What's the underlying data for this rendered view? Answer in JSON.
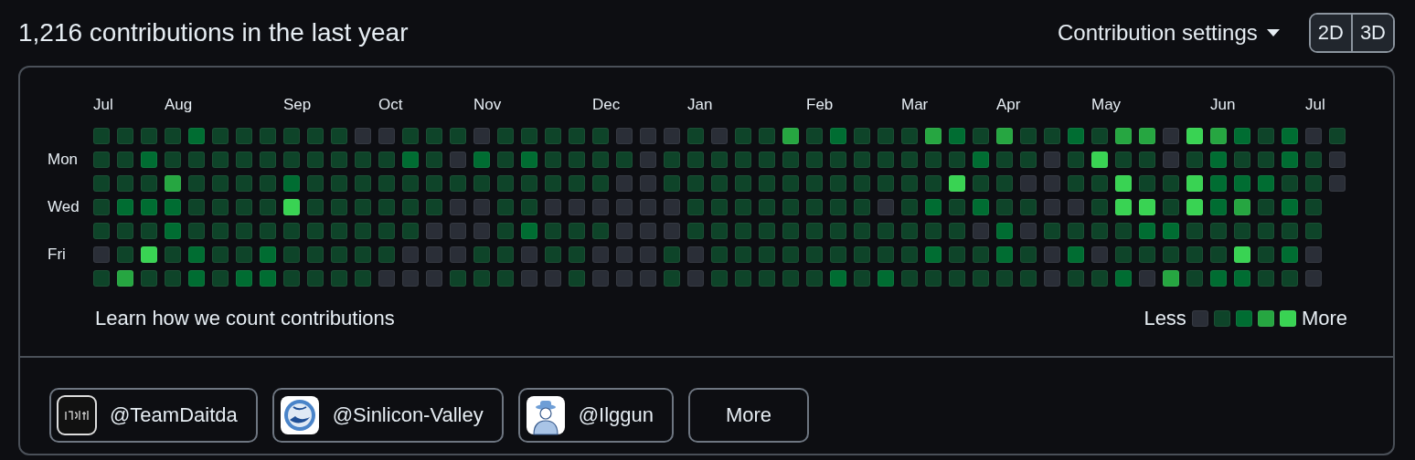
{
  "title": "1,216 contributions in the last year",
  "settings": {
    "label": "Contribution settings"
  },
  "view_toggle": [
    {
      "label": "2D"
    },
    {
      "label": "3D"
    }
  ],
  "day_labels": [
    "Mon",
    "Wed",
    "Fri"
  ],
  "weeks": [
    {
      "month": "Jul",
      "days": [
        {
          "color": "#0e4429"
        },
        {
          "color": "#0e4429"
        },
        {
          "color": "#0e4429"
        },
        {
          "color": "#0e4429"
        },
        {
          "color": "#0e4429"
        },
        {
          "color": "#2a2e37"
        },
        {
          "color": "#0e4429"
        }
      ]
    },
    {
      "days": [
        {
          "color": "#0e4429"
        },
        {
          "color": "#0e4429"
        },
        {
          "color": "#0e4429"
        },
        {
          "color": "#006d32"
        },
        {
          "color": "#0e4429"
        },
        {
          "color": "#0e4429"
        },
        {
          "color": "#26a641"
        }
      ]
    },
    {
      "days": [
        {
          "color": "#0e4429"
        },
        {
          "color": "#006d32"
        },
        {
          "color": "#0e4429"
        },
        {
          "color": "#006d32"
        },
        {
          "color": "#0e4429"
        },
        {
          "color": "#39d353"
        },
        {
          "color": "#0e4429"
        }
      ]
    },
    {
      "month": "Aug",
      "days": [
        {
          "color": "#0e4429"
        },
        {
          "color": "#0e4429"
        },
        {
          "color": "#26a641"
        },
        {
          "color": "#006d32"
        },
        {
          "color": "#006d32"
        },
        {
          "color": "#0e4429"
        },
        {
          "color": "#0e4429"
        }
      ]
    },
    {
      "days": [
        {
          "color": "#006d32"
        },
        {
          "color": "#0e4429"
        },
        {
          "color": "#0e4429"
        },
        {
          "color": "#0e4429"
        },
        {
          "color": "#0e4429"
        },
        {
          "color": "#006d32"
        },
        {
          "color": "#006d32"
        }
      ]
    },
    {
      "days": [
        {
          "color": "#0e4429"
        },
        {
          "color": "#0e4429"
        },
        {
          "color": "#0e4429"
        },
        {
          "color": "#0e4429"
        },
        {
          "color": "#0e4429"
        },
        {
          "color": "#0e4429"
        },
        {
          "color": "#0e4429"
        }
      ]
    },
    {
      "days": [
        {
          "color": "#0e4429"
        },
        {
          "color": "#0e4429"
        },
        {
          "color": "#0e4429"
        },
        {
          "color": "#0e4429"
        },
        {
          "color": "#0e4429"
        },
        {
          "color": "#0e4429"
        },
        {
          "color": "#006d32"
        }
      ]
    },
    {
      "days": [
        {
          "color": "#0e4429"
        },
        {
          "color": "#0e4429"
        },
        {
          "color": "#0e4429"
        },
        {
          "color": "#0e4429"
        },
        {
          "color": "#0e4429"
        },
        {
          "color": "#006d32"
        },
        {
          "color": "#006d32"
        }
      ]
    },
    {
      "month": "Sep",
      "days": [
        {
          "color": "#0e4429"
        },
        {
          "color": "#0e4429"
        },
        {
          "color": "#006d32"
        },
        {
          "color": "#39d353"
        },
        {
          "color": "#0e4429"
        },
        {
          "color": "#0e4429"
        },
        {
          "color": "#0e4429"
        }
      ]
    },
    {
      "days": [
        {
          "color": "#0e4429"
        },
        {
          "color": "#0e4429"
        },
        {
          "color": "#0e4429"
        },
        {
          "color": "#0e4429"
        },
        {
          "color": "#0e4429"
        },
        {
          "color": "#0e4429"
        },
        {
          "color": "#0e4429"
        }
      ]
    },
    {
      "days": [
        {
          "color": "#0e4429"
        },
        {
          "color": "#0e4429"
        },
        {
          "color": "#0e4429"
        },
        {
          "color": "#0e4429"
        },
        {
          "color": "#0e4429"
        },
        {
          "color": "#0e4429"
        },
        {
          "color": "#0e4429"
        }
      ]
    },
    {
      "days": [
        {
          "color": "#2a2e37"
        },
        {
          "color": "#0e4429"
        },
        {
          "color": "#0e4429"
        },
        {
          "color": "#0e4429"
        },
        {
          "color": "#0e4429"
        },
        {
          "color": "#0e4429"
        },
        {
          "color": "#0e4429"
        }
      ]
    },
    {
      "month": "Oct",
      "days": [
        {
          "color": "#2a2e37"
        },
        {
          "color": "#0e4429"
        },
        {
          "color": "#0e4429"
        },
        {
          "color": "#0e4429"
        },
        {
          "color": "#0e4429"
        },
        {
          "color": "#0e4429"
        },
        {
          "color": "#2a2e37"
        }
      ]
    },
    {
      "days": [
        {
          "color": "#0e4429"
        },
        {
          "color": "#006d32"
        },
        {
          "color": "#0e4429"
        },
        {
          "color": "#0e4429"
        },
        {
          "color": "#0e4429"
        },
        {
          "color": "#2a2e37"
        },
        {
          "color": "#2a2e37"
        }
      ]
    },
    {
      "days": [
        {
          "color": "#0e4429"
        },
        {
          "color": "#0e4429"
        },
        {
          "color": "#0e4429"
        },
        {
          "color": "#0e4429"
        },
        {
          "color": "#2a2e37"
        },
        {
          "color": "#2a2e37"
        },
        {
          "color": "#2a2e37"
        }
      ]
    },
    {
      "days": [
        {
          "color": "#0e4429"
        },
        {
          "color": "#2a2e37"
        },
        {
          "color": "#0e4429"
        },
        {
          "color": "#2a2e37"
        },
        {
          "color": "#2a2e37"
        },
        {
          "color": "#2a2e37"
        },
        {
          "color": "#0e4429"
        }
      ]
    },
    {
      "month": "Nov",
      "days": [
        {
          "color": "#2a2e37"
        },
        {
          "color": "#006d32"
        },
        {
          "color": "#0e4429"
        },
        {
          "color": "#2a2e37"
        },
        {
          "color": "#2a2e37"
        },
        {
          "color": "#0e4429"
        },
        {
          "color": "#0e4429"
        }
      ]
    },
    {
      "days": [
        {
          "color": "#0e4429"
        },
        {
          "color": "#0e4429"
        },
        {
          "color": "#0e4429"
        },
        {
          "color": "#0e4429"
        },
        {
          "color": "#0e4429"
        },
        {
          "color": "#0e4429"
        },
        {
          "color": "#0e4429"
        }
      ]
    },
    {
      "days": [
        {
          "color": "#0e4429"
        },
        {
          "color": "#006d32"
        },
        {
          "color": "#0e4429"
        },
        {
          "color": "#0e4429"
        },
        {
          "color": "#006d32"
        },
        {
          "color": "#2a2e37"
        },
        {
          "color": "#2a2e37"
        }
      ]
    },
    {
      "days": [
        {
          "color": "#0e4429"
        },
        {
          "color": "#0e4429"
        },
        {
          "color": "#0e4429"
        },
        {
          "color": "#2a2e37"
        },
        {
          "color": "#0e4429"
        },
        {
          "color": "#0e4429"
        },
        {
          "color": "#2a2e37"
        }
      ]
    },
    {
      "days": [
        {
          "color": "#0e4429"
        },
        {
          "color": "#0e4429"
        },
        {
          "color": "#0e4429"
        },
        {
          "color": "#2a2e37"
        },
        {
          "color": "#0e4429"
        },
        {
          "color": "#0e4429"
        },
        {
          "color": "#0e4429"
        }
      ]
    },
    {
      "month": "Dec",
      "days": [
        {
          "color": "#0e4429"
        },
        {
          "color": "#0e4429"
        },
        {
          "color": "#0e4429"
        },
        {
          "color": "#2a2e37"
        },
        {
          "color": "#0e4429"
        },
        {
          "color": "#2a2e37"
        },
        {
          "color": "#2a2e37"
        }
      ]
    },
    {
      "days": [
        {
          "color": "#2a2e37"
        },
        {
          "color": "#0e4429"
        },
        {
          "color": "#2a2e37"
        },
        {
          "color": "#2a2e37"
        },
        {
          "color": "#2a2e37"
        },
        {
          "color": "#2a2e37"
        },
        {
          "color": "#2a2e37"
        }
      ]
    },
    {
      "days": [
        {
          "color": "#2a2e37"
        },
        {
          "color": "#2a2e37"
        },
        {
          "color": "#2a2e37"
        },
        {
          "color": "#2a2e37"
        },
        {
          "color": "#2a2e37"
        },
        {
          "color": "#2a2e37"
        },
        {
          "color": "#2a2e37"
        }
      ]
    },
    {
      "days": [
        {
          "color": "#2a2e37"
        },
        {
          "color": "#0e4429"
        },
        {
          "color": "#0e4429"
        },
        {
          "color": "#2a2e37"
        },
        {
          "color": "#2a2e37"
        },
        {
          "color": "#0e4429"
        },
        {
          "color": "#0e4429"
        }
      ]
    },
    {
      "month": "Jan",
      "days": [
        {
          "color": "#0e4429"
        },
        {
          "color": "#0e4429"
        },
        {
          "color": "#0e4429"
        },
        {
          "color": "#0e4429"
        },
        {
          "color": "#0e4429"
        },
        {
          "color": "#2a2e37"
        },
        {
          "color": "#2a2e37"
        }
      ]
    },
    {
      "days": [
        {
          "color": "#2a2e37"
        },
        {
          "color": "#0e4429"
        },
        {
          "color": "#0e4429"
        },
        {
          "color": "#0e4429"
        },
        {
          "color": "#0e4429"
        },
        {
          "color": "#0e4429"
        },
        {
          "color": "#0e4429"
        }
      ]
    },
    {
      "days": [
        {
          "color": "#0e4429"
        },
        {
          "color": "#0e4429"
        },
        {
          "color": "#0e4429"
        },
        {
          "color": "#0e4429"
        },
        {
          "color": "#0e4429"
        },
        {
          "color": "#0e4429"
        },
        {
          "color": "#0e4429"
        }
      ]
    },
    {
      "days": [
        {
          "color": "#0e4429"
        },
        {
          "color": "#0e4429"
        },
        {
          "color": "#0e4429"
        },
        {
          "color": "#0e4429"
        },
        {
          "color": "#0e4429"
        },
        {
          "color": "#0e4429"
        },
        {
          "color": "#0e4429"
        }
      ]
    },
    {
      "days": [
        {
          "color": "#26a641"
        },
        {
          "color": "#0e4429"
        },
        {
          "color": "#0e4429"
        },
        {
          "color": "#0e4429"
        },
        {
          "color": "#0e4429"
        },
        {
          "color": "#0e4429"
        },
        {
          "color": "#0e4429"
        }
      ]
    },
    {
      "month": "Feb",
      "days": [
        {
          "color": "#0e4429"
        },
        {
          "color": "#0e4429"
        },
        {
          "color": "#0e4429"
        },
        {
          "color": "#0e4429"
        },
        {
          "color": "#0e4429"
        },
        {
          "color": "#0e4429"
        },
        {
          "color": "#0e4429"
        }
      ]
    },
    {
      "days": [
        {
          "color": "#006d32"
        },
        {
          "color": "#0e4429"
        },
        {
          "color": "#0e4429"
        },
        {
          "color": "#0e4429"
        },
        {
          "color": "#0e4429"
        },
        {
          "color": "#0e4429"
        },
        {
          "color": "#006d32"
        }
      ]
    },
    {
      "days": [
        {
          "color": "#0e4429"
        },
        {
          "color": "#0e4429"
        },
        {
          "color": "#0e4429"
        },
        {
          "color": "#0e4429"
        },
        {
          "color": "#0e4429"
        },
        {
          "color": "#0e4429"
        },
        {
          "color": "#0e4429"
        }
      ]
    },
    {
      "days": [
        {
          "color": "#0e4429"
        },
        {
          "color": "#0e4429"
        },
        {
          "color": "#0e4429"
        },
        {
          "color": "#2a2e37"
        },
        {
          "color": "#0e4429"
        },
        {
          "color": "#0e4429"
        },
        {
          "color": "#006d32"
        }
      ]
    },
    {
      "month": "Mar",
      "days": [
        {
          "color": "#0e4429"
        },
        {
          "color": "#0e4429"
        },
        {
          "color": "#0e4429"
        },
        {
          "color": "#0e4429"
        },
        {
          "color": "#0e4429"
        },
        {
          "color": "#0e4429"
        },
        {
          "color": "#0e4429"
        }
      ]
    },
    {
      "days": [
        {
          "color": "#26a641"
        },
        {
          "color": "#0e4429"
        },
        {
          "color": "#0e4429"
        },
        {
          "color": "#006d32"
        },
        {
          "color": "#0e4429"
        },
        {
          "color": "#006d32"
        },
        {
          "color": "#0e4429"
        }
      ]
    },
    {
      "days": [
        {
          "color": "#006d32"
        },
        {
          "color": "#0e4429"
        },
        {
          "color": "#39d353"
        },
        {
          "color": "#0e4429"
        },
        {
          "color": "#0e4429"
        },
        {
          "color": "#0e4429"
        },
        {
          "color": "#0e4429"
        }
      ]
    },
    {
      "days": [
        {
          "color": "#0e4429"
        },
        {
          "color": "#006d32"
        },
        {
          "color": "#0e4429"
        },
        {
          "color": "#006d32"
        },
        {
          "color": "#2a2e37"
        },
        {
          "color": "#0e4429"
        },
        {
          "color": "#0e4429"
        }
      ]
    },
    {
      "month": "Apr",
      "days": [
        {
          "color": "#26a641"
        },
        {
          "color": "#0e4429"
        },
        {
          "color": "#0e4429"
        },
        {
          "color": "#0e4429"
        },
        {
          "color": "#006d32"
        },
        {
          "color": "#006d32"
        },
        {
          "color": "#0e4429"
        }
      ]
    },
    {
      "days": [
        {
          "color": "#0e4429"
        },
        {
          "color": "#0e4429"
        },
        {
          "color": "#2a2e37"
        },
        {
          "color": "#0e4429"
        },
        {
          "color": "#2a2e37"
        },
        {
          "color": "#0e4429"
        },
        {
          "color": "#0e4429"
        }
      ]
    },
    {
      "days": [
        {
          "color": "#0e4429"
        },
        {
          "color": "#2a2e37"
        },
        {
          "color": "#2a2e37"
        },
        {
          "color": "#2a2e37"
        },
        {
          "color": "#0e4429"
        },
        {
          "color": "#2a2e37"
        },
        {
          "color": "#2a2e37"
        }
      ]
    },
    {
      "days": [
        {
          "color": "#006d32"
        },
        {
          "color": "#0e4429"
        },
        {
          "color": "#0e4429"
        },
        {
          "color": "#2a2e37"
        },
        {
          "color": "#0e4429"
        },
        {
          "color": "#006d32"
        },
        {
          "color": "#0e4429"
        }
      ]
    },
    {
      "month": "May",
      "days": [
        {
          "color": "#0e4429"
        },
        {
          "color": "#39d353"
        },
        {
          "color": "#0e4429"
        },
        {
          "color": "#0e4429"
        },
        {
          "color": "#0e4429"
        },
        {
          "color": "#2a2e37"
        },
        {
          "color": "#0e4429"
        }
      ]
    },
    {
      "days": [
        {
          "color": "#26a641"
        },
        {
          "color": "#0e4429"
        },
        {
          "color": "#39d353"
        },
        {
          "color": "#39d353"
        },
        {
          "color": "#0e4429"
        },
        {
          "color": "#0e4429"
        },
        {
          "color": "#006d32"
        }
      ]
    },
    {
      "days": [
        {
          "color": "#26a641"
        },
        {
          "color": "#0e4429"
        },
        {
          "color": "#0e4429"
        },
        {
          "color": "#39d353"
        },
        {
          "color": "#006d32"
        },
        {
          "color": "#0e4429"
        },
        {
          "color": "#2a2e37"
        }
      ]
    },
    {
      "days": [
        {
          "color": "#2a2e37"
        },
        {
          "color": "#2a2e37"
        },
        {
          "color": "#0e4429"
        },
        {
          "color": "#0e4429"
        },
        {
          "color": "#006d32"
        },
        {
          "color": "#0e4429"
        },
        {
          "color": "#26a641"
        }
      ]
    },
    {
      "days": [
        {
          "color": "#39d353"
        },
        {
          "color": "#0e4429"
        },
        {
          "color": "#39d353"
        },
        {
          "color": "#39d353"
        },
        {
          "color": "#0e4429"
        },
        {
          "color": "#0e4429"
        },
        {
          "color": "#0e4429"
        }
      ]
    },
    {
      "month": "Jun",
      "days": [
        {
          "color": "#26a641"
        },
        {
          "color": "#006d32"
        },
        {
          "color": "#006d32"
        },
        {
          "color": "#006d32"
        },
        {
          "color": "#0e4429"
        },
        {
          "color": "#0e4429"
        },
        {
          "color": "#006d32"
        }
      ]
    },
    {
      "days": [
        {
          "color": "#006d32"
        },
        {
          "color": "#0e4429"
        },
        {
          "color": "#006d32"
        },
        {
          "color": "#26a641"
        },
        {
          "color": "#0e4429"
        },
        {
          "color": "#39d353"
        },
        {
          "color": "#006d32"
        }
      ]
    },
    {
      "days": [
        {
          "color": "#0e4429"
        },
        {
          "color": "#0e4429"
        },
        {
          "color": "#006d32"
        },
        {
          "color": "#0e4429"
        },
        {
          "color": "#0e4429"
        },
        {
          "color": "#0e4429"
        },
        {
          "color": "#0e4429"
        }
      ]
    },
    {
      "days": [
        {
          "color": "#006d32"
        },
        {
          "color": "#006d32"
        },
        {
          "color": "#0e4429"
        },
        {
          "color": "#006d32"
        },
        {
          "color": "#0e4429"
        },
        {
          "color": "#006d32"
        },
        {
          "color": "#0e4429"
        }
      ]
    },
    {
      "month": "Jul",
      "days": [
        {
          "color": "#2a2e37"
        },
        {
          "color": "#0e4429"
        },
        {
          "color": "#0e4429"
        },
        {
          "color": "#0e4429"
        },
        {
          "color": "#0e4429"
        },
        {
          "color": "#2a2e37"
        },
        {
          "color": "#2a2e37"
        }
      ]
    },
    {
      "days": [
        {
          "color": "#0e4429"
        },
        {
          "color": "#2a2e37"
        },
        {
          "color": "#2a2e37"
        }
      ]
    }
  ],
  "learn_link": "Learn how we count contributions",
  "legend": {
    "less": "Less",
    "more": "More",
    "swatches": [
      {
        "color": "#2a2e37"
      },
      {
        "color": "#0e4429"
      },
      {
        "color": "#006d32"
      },
      {
        "color": "#26a641"
      },
      {
        "color": "#39d353"
      }
    ]
  },
  "organizations": [
    {
      "handle": "@TeamDaitda",
      "kind": "dark-logo"
    },
    {
      "handle": "@Sinlicon-Valley",
      "kind": "blue-logo"
    },
    {
      "handle": "@Ilggun",
      "kind": "person"
    }
  ],
  "more_button": "More"
}
